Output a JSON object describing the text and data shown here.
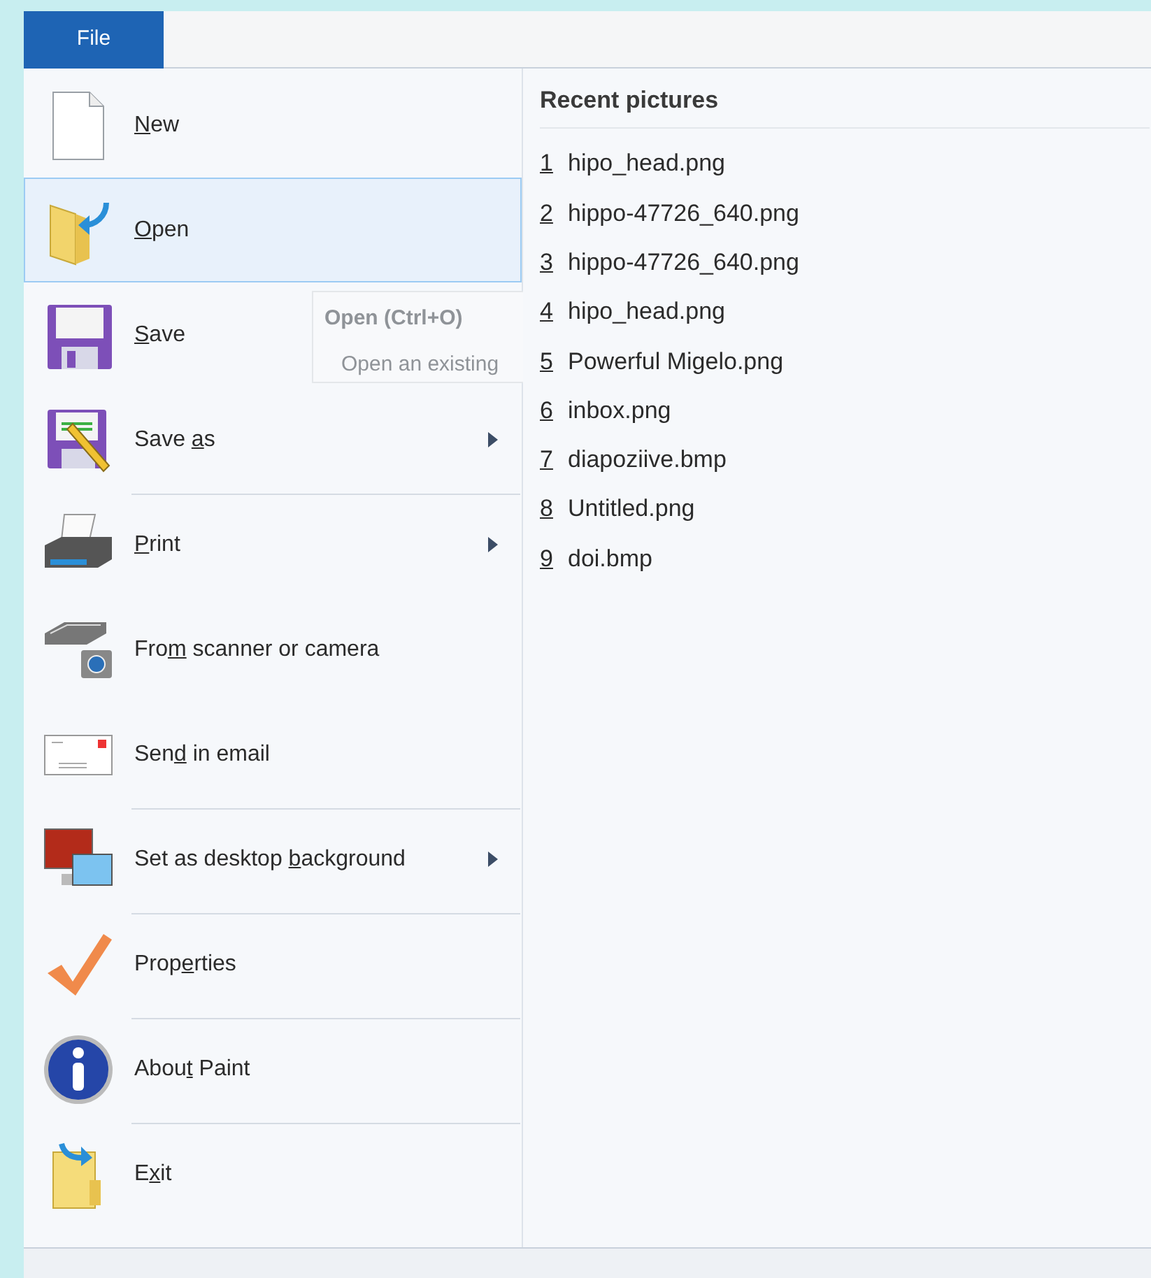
{
  "file_tab": {
    "label": "File",
    "selected": true
  },
  "menu": [
    {
      "label": {
        "key": "N",
        "after": "ew"
      },
      "selected": false,
      "submenu": false,
      "separator_above": false
    },
    {
      "label": {
        "key": "O",
        "after": "pen"
      },
      "selected": true,
      "submenu": false,
      "separator_above": false
    },
    {
      "label": {
        "key": "S",
        "after": "ave"
      },
      "selected": false,
      "submenu": false,
      "separator_above": false
    },
    {
      "label": {
        "before": "Save ",
        "key": "a",
        "after": "s"
      },
      "selected": false,
      "submenu": true,
      "separator_above": false
    },
    {
      "label": {
        "key": "P",
        "after": "rint"
      },
      "selected": false,
      "submenu": true,
      "separator_above": true
    },
    {
      "label": {
        "before": "Fro",
        "key": "m",
        "after": " scanner or camera"
      },
      "selected": false,
      "submenu": false,
      "separator_above": false
    },
    {
      "label": {
        "before": "Sen",
        "key": "d",
        "after": " in email"
      },
      "selected": false,
      "submenu": false,
      "separator_above": false
    },
    {
      "label": {
        "before": "Set as desktop ",
        "key": "b",
        "after": "ackground"
      },
      "selected": false,
      "submenu": true,
      "separator_above": true
    },
    {
      "label": {
        "before": "Prop",
        "key": "e",
        "after": "rties"
      },
      "selected": false,
      "submenu": false,
      "separator_above": true
    },
    {
      "label": {
        "before": "Abou",
        "key": "t",
        "after": " Paint"
      },
      "selected": false,
      "submenu": false,
      "separator_above": true
    },
    {
      "label": {
        "before": "E",
        "key": "x",
        "after": "it"
      },
      "selected": false,
      "submenu": false,
      "separator_above": true
    }
  ],
  "tooltip": {
    "title": "Open (Ctrl+O)",
    "text": "Open an existing"
  },
  "recent": {
    "title": "Recent pictures",
    "items": [
      {
        "number": "1",
        "name": "hipo_head.png"
      },
      {
        "number": "2",
        "name": "hippo-47726_640.png"
      },
      {
        "number": "3",
        "name": "hippo-47726_640.png"
      },
      {
        "number": "4",
        "name": "hipo_head.png"
      },
      {
        "number": "5",
        "name": "Powerful Migelo.png"
      },
      {
        "number": "6",
        "name": "inbox.png"
      },
      {
        "number": "7",
        "name": "diapoziive.bmp"
      },
      {
        "number": "8",
        "name": "Untitled.png"
      },
      {
        "number": "9",
        "name": "doi.bmp"
      }
    ]
  }
}
